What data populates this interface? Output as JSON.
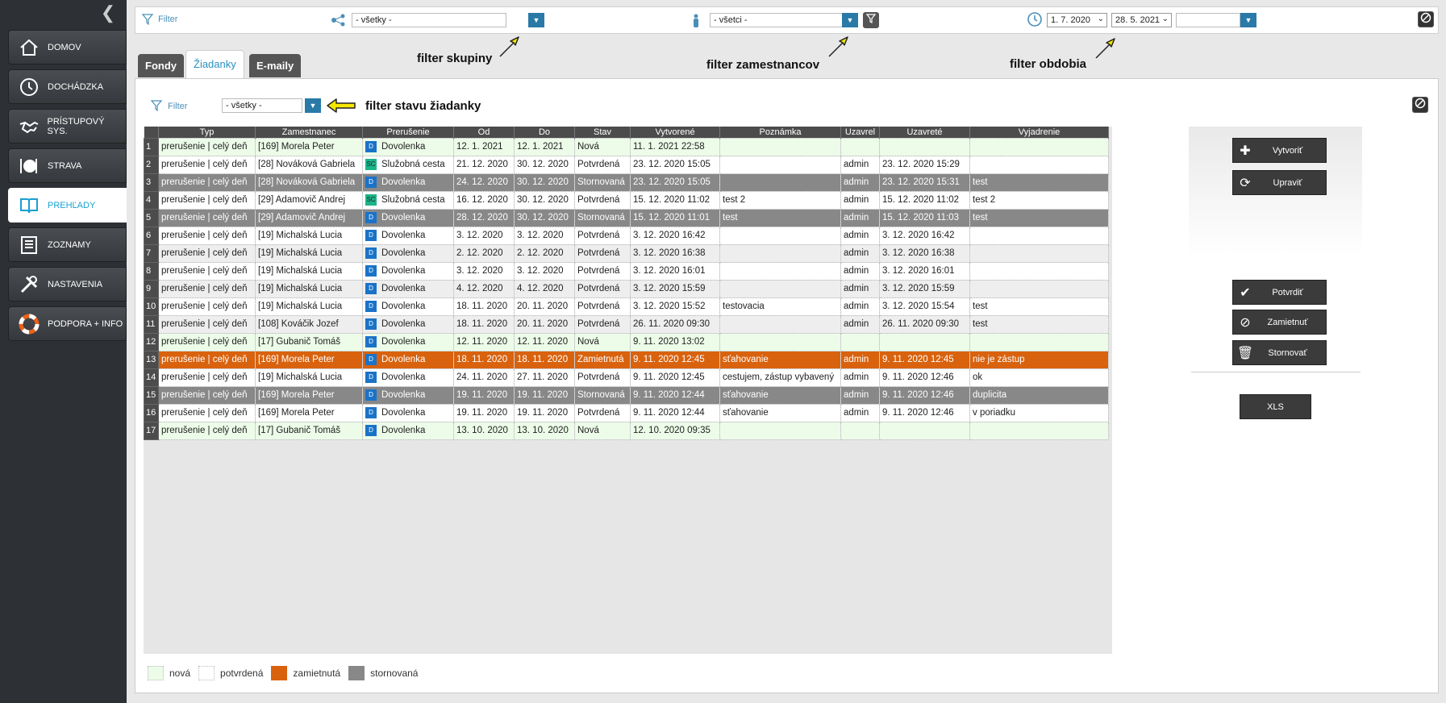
{
  "sidebar": {
    "items": [
      {
        "label": "DOMOV",
        "icon": "house-icon"
      },
      {
        "label": "DOCHÁDZKA",
        "icon": "clock-icon"
      },
      {
        "label": "PRÍSTUPOVÝ SYS.",
        "icon": "handshake-icon"
      },
      {
        "label": "STRAVA",
        "icon": "plate-icon"
      },
      {
        "label": "PREHĽADY",
        "icon": "book-icon"
      },
      {
        "label": "ZOZNAMY",
        "icon": "list-icon"
      },
      {
        "label": "NASTAVENIA",
        "icon": "tools-icon"
      },
      {
        "label": "PODPORA + INFO",
        "icon": "lifebuoy-icon"
      }
    ]
  },
  "topbar": {
    "filter_label": "Filter",
    "group_value": "- všetky -",
    "employee_value": "- všetci -",
    "date_from": "1. 7. 2020",
    "date_to": "28. 5. 2021",
    "period_value": ""
  },
  "annotations": {
    "group": "filter skupiny",
    "employee": "filter zamestnancov",
    "period": "filter obdobia",
    "status": "filter stavu žiadanky"
  },
  "tabs": [
    {
      "label": "Fondy"
    },
    {
      "label": "Žiadanky"
    },
    {
      "label": "E-maily"
    }
  ],
  "main": {
    "filter_label": "Filter",
    "status_value": "- všetky -"
  },
  "table": {
    "columns": [
      "Typ",
      "Zamestnanec",
      "Prerušenie",
      "Od",
      "Do",
      "Stav",
      "Vytvorené",
      "Poznámka",
      "Uzavrel",
      "Uzavreté",
      "Vyjadrenie"
    ],
    "rows": [
      {
        "n": "1",
        "typ": "prerušenie | celý deň",
        "emp": "[169] Morela Peter",
        "badge": "D",
        "prer": "Dovolenka",
        "od": "12. 1. 2021",
        "do": "12. 1. 2021",
        "stav": "Nová",
        "vytv": "11. 1. 2021  22:58",
        "pozn": "",
        "uzavrel": "",
        "uzavrete": "",
        "vyj": "",
        "cls": "s-nova"
      },
      {
        "n": "2",
        "typ": "prerušenie | celý deň",
        "emp": "[28] Nováková Gabriela",
        "badge": "SC",
        "prer": "Služobná cesta",
        "od": "21. 12. 2020",
        "do": "30. 12. 2020",
        "stav": "Potvrdená",
        "vytv": "23. 12. 2020  15:05",
        "pozn": "",
        "uzavrel": "admin",
        "uzavrete": "23. 12. 2020  15:29",
        "vyj": "",
        "cls": "s-potv"
      },
      {
        "n": "3",
        "typ": "prerušenie | celý deň",
        "emp": "[28] Nováková Gabriela",
        "badge": "D",
        "prer": "Dovolenka",
        "od": "24. 12. 2020",
        "do": "30. 12. 2020",
        "stav": "Stornovaná",
        "vytv": "23. 12. 2020  15:05",
        "pozn": "",
        "uzavrel": "admin",
        "uzavrete": "23. 12. 2020  15:31",
        "vyj": "test",
        "cls": "s-storno"
      },
      {
        "n": "4",
        "typ": "prerušenie | celý deň",
        "emp": "[29] Adamovič Andrej",
        "badge": "SC",
        "prer": "Služobná cesta",
        "od": "16. 12. 2020",
        "do": "30. 12. 2020",
        "stav": "Potvrdená",
        "vytv": "15. 12. 2020  11:02",
        "pozn": "test 2",
        "uzavrel": "admin",
        "uzavrete": "15. 12. 2020  11:02",
        "vyj": "test 2",
        "cls": "s-potv"
      },
      {
        "n": "5",
        "typ": "prerušenie | celý deň",
        "emp": "[29] Adamovič Andrej",
        "badge": "D",
        "prer": "Dovolenka",
        "od": "28. 12. 2020",
        "do": "30. 12. 2020",
        "stav": "Stornovaná",
        "vytv": "15. 12. 2020  11:01",
        "pozn": "test",
        "uzavrel": "admin",
        "uzavrete": "15. 12. 2020  11:03",
        "vyj": "test",
        "cls": "s-storno"
      },
      {
        "n": "6",
        "typ": "prerušenie | celý deň",
        "emp": "[19] Michalská Lucia",
        "badge": "D",
        "prer": "Dovolenka",
        "od": "3. 12. 2020",
        "do": "3. 12. 2020",
        "stav": "Potvrdená",
        "vytv": "3. 12. 2020  16:42",
        "pozn": "",
        "uzavrel": "admin",
        "uzavrete": "3. 12. 2020  16:42",
        "vyj": "",
        "cls": "s-potv"
      },
      {
        "n": "7",
        "typ": "prerušenie | celý deň",
        "emp": "[19] Michalská Lucia",
        "badge": "D",
        "prer": "Dovolenka",
        "od": "2. 12. 2020",
        "do": "2. 12. 2020",
        "stav": "Potvrdená",
        "vytv": "3. 12. 2020  16:38",
        "pozn": "",
        "uzavrel": "admin",
        "uzavrete": "3. 12. 2020  16:38",
        "vyj": "",
        "cls": "s-potv alt"
      },
      {
        "n": "8",
        "typ": "prerušenie | celý deň",
        "emp": "[19] Michalská Lucia",
        "badge": "D",
        "prer": "Dovolenka",
        "od": "3. 12. 2020",
        "do": "3. 12. 2020",
        "stav": "Potvrdená",
        "vytv": "3. 12. 2020  16:01",
        "pozn": "",
        "uzavrel": "admin",
        "uzavrete": "3. 12. 2020  16:01",
        "vyj": "",
        "cls": "s-potv"
      },
      {
        "n": "9",
        "typ": "prerušenie | celý deň",
        "emp": "[19] Michalská Lucia",
        "badge": "D",
        "prer": "Dovolenka",
        "od": "4. 12. 2020",
        "do": "4. 12. 2020",
        "stav": "Potvrdená",
        "vytv": "3. 12. 2020  15:59",
        "pozn": "",
        "uzavrel": "admin",
        "uzavrete": "3. 12. 2020  15:59",
        "vyj": "",
        "cls": "s-potv alt"
      },
      {
        "n": "10",
        "typ": "prerušenie | celý deň",
        "emp": "[19] Michalská Lucia",
        "badge": "D",
        "prer": "Dovolenka",
        "od": "18. 11. 2020",
        "do": "20. 11. 2020",
        "stav": "Potvrdená",
        "vytv": "3. 12. 2020  15:52",
        "pozn": "testovacia",
        "uzavrel": "admin",
        "uzavrete": "3. 12. 2020  15:54",
        "vyj": "test",
        "cls": "s-potv"
      },
      {
        "n": "11",
        "typ": "prerušenie | celý deň",
        "emp": "[108] Kováčik Jozef",
        "badge": "D",
        "prer": "Dovolenka",
        "od": "18. 11. 2020",
        "do": "20. 11. 2020",
        "stav": "Potvrdená",
        "vytv": "26. 11. 2020  09:30",
        "pozn": "",
        "uzavrel": "admin",
        "uzavrete": "26. 11. 2020  09:30",
        "vyj": "test",
        "cls": "s-potv alt"
      },
      {
        "n": "12",
        "typ": "prerušenie | celý deň",
        "emp": "[17] Gubanič Tomáš",
        "badge": "D",
        "prer": "Dovolenka",
        "od": "12. 11. 2020",
        "do": "12. 11. 2020",
        "stav": "Nová",
        "vytv": "9. 11. 2020  13:02",
        "pozn": "",
        "uzavrel": "",
        "uzavrete": "",
        "vyj": "",
        "cls": "s-nova"
      },
      {
        "n": "13",
        "typ": "prerušenie | celý deň",
        "emp": "[169] Morela Peter",
        "badge": "D",
        "prer": "Dovolenka",
        "od": "18. 11. 2020",
        "do": "18. 11. 2020",
        "stav": "Zamietnutá",
        "vytv": "9. 11. 2020  12:45",
        "pozn": "sťahovanie",
        "uzavrel": "admin",
        "uzavrete": "9. 11. 2020  12:45",
        "vyj": "nie je zástup",
        "cls": "s-zam"
      },
      {
        "n": "14",
        "typ": "prerušenie | celý deň",
        "emp": "[19] Michalská Lucia",
        "badge": "D",
        "prer": "Dovolenka",
        "od": "24. 11. 2020",
        "do": "27. 11. 2020",
        "stav": "Potvrdená",
        "vytv": "9. 11. 2020  12:45",
        "pozn": "cestujem, zástup vybavený",
        "uzavrel": "admin",
        "uzavrete": "9. 11. 2020  12:46",
        "vyj": "ok",
        "cls": "s-potv"
      },
      {
        "n": "15",
        "typ": "prerušenie | celý deň",
        "emp": "[169] Morela Peter",
        "badge": "D",
        "prer": "Dovolenka",
        "od": "19. 11. 2020",
        "do": "19. 11. 2020",
        "stav": "Stornovaná",
        "vytv": "9. 11. 2020  12:44",
        "pozn": "sťahovanie",
        "uzavrel": "admin",
        "uzavrete": "9. 11. 2020  12:46",
        "vyj": "duplicita",
        "cls": "s-storno"
      },
      {
        "n": "16",
        "typ": "prerušenie | celý deň",
        "emp": "[169] Morela Peter",
        "badge": "D",
        "prer": "Dovolenka",
        "od": "19. 11. 2020",
        "do": "19. 11. 2020",
        "stav": "Potvrdená",
        "vytv": "9. 11. 2020  12:44",
        "pozn": "sťahovanie",
        "uzavrel": "admin",
        "uzavrete": "9. 11. 2020  12:46",
        "vyj": "v poriadku",
        "cls": "s-potv"
      },
      {
        "n": "17",
        "typ": "prerušenie | celý deň",
        "emp": "[17] Gubanič Tomáš",
        "badge": "D",
        "prer": "Dovolenka",
        "od": "13. 10. 2020",
        "do": "13. 10. 2020",
        "stav": "Nová",
        "vytv": "12. 10. 2020  09:35",
        "pozn": "",
        "uzavrel": "",
        "uzavrete": "",
        "vyj": "",
        "cls": "s-nova"
      }
    ]
  },
  "actions": {
    "create": "Vytvoriť",
    "edit": "Upraviť",
    "confirm": "Potvrdiť",
    "reject": "Zamietnuť",
    "cancel": "Stornovať",
    "xls": "XLS"
  },
  "legend": [
    {
      "label": "nová",
      "color": "#ecfce8"
    },
    {
      "label": "potvrdená",
      "color": "#ffffff"
    },
    {
      "label": "zamietnutá",
      "color": "#d9620e"
    },
    {
      "label": "stornovaná",
      "color": "#888888"
    }
  ]
}
